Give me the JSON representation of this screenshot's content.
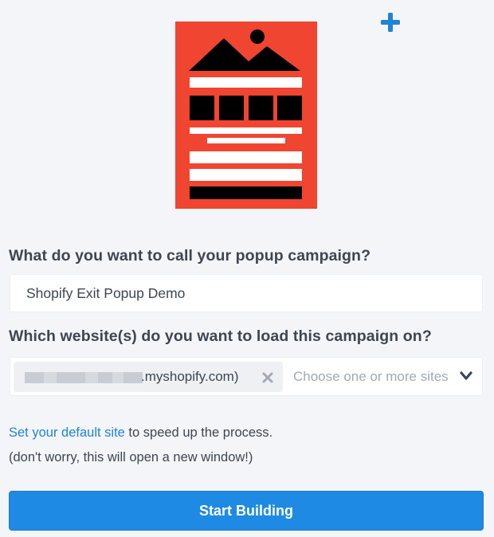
{
  "illustration": {
    "icon": "popup-template-thumbnail",
    "background_color": "#f04530"
  },
  "add_icon": {
    "icon": "plus-icon",
    "color": "#1f84d6"
  },
  "form": {
    "name_question": "What do you want to call your popup campaign?",
    "name_value": "Shopify Exit Popup Demo",
    "site_question": "Which website(s) do you want to load this campaign on?",
    "selected_site_suffix": ".myshopify.com)",
    "selected_site_remove_icon": "close-icon",
    "site_placeholder": "Choose one or more sites",
    "dropdown_icon": "chevron-down-icon"
  },
  "helper": {
    "link_text": "Set your default site",
    "line1_rest": " to speed up the process.",
    "line2": "(don't worry, this will open a new window!)"
  },
  "actions": {
    "start_label": "Start Building"
  },
  "colors": {
    "accent": "#1f8ae3",
    "link": "#1f84d6",
    "background": "#f4f5f8",
    "text": "#3f4651"
  }
}
